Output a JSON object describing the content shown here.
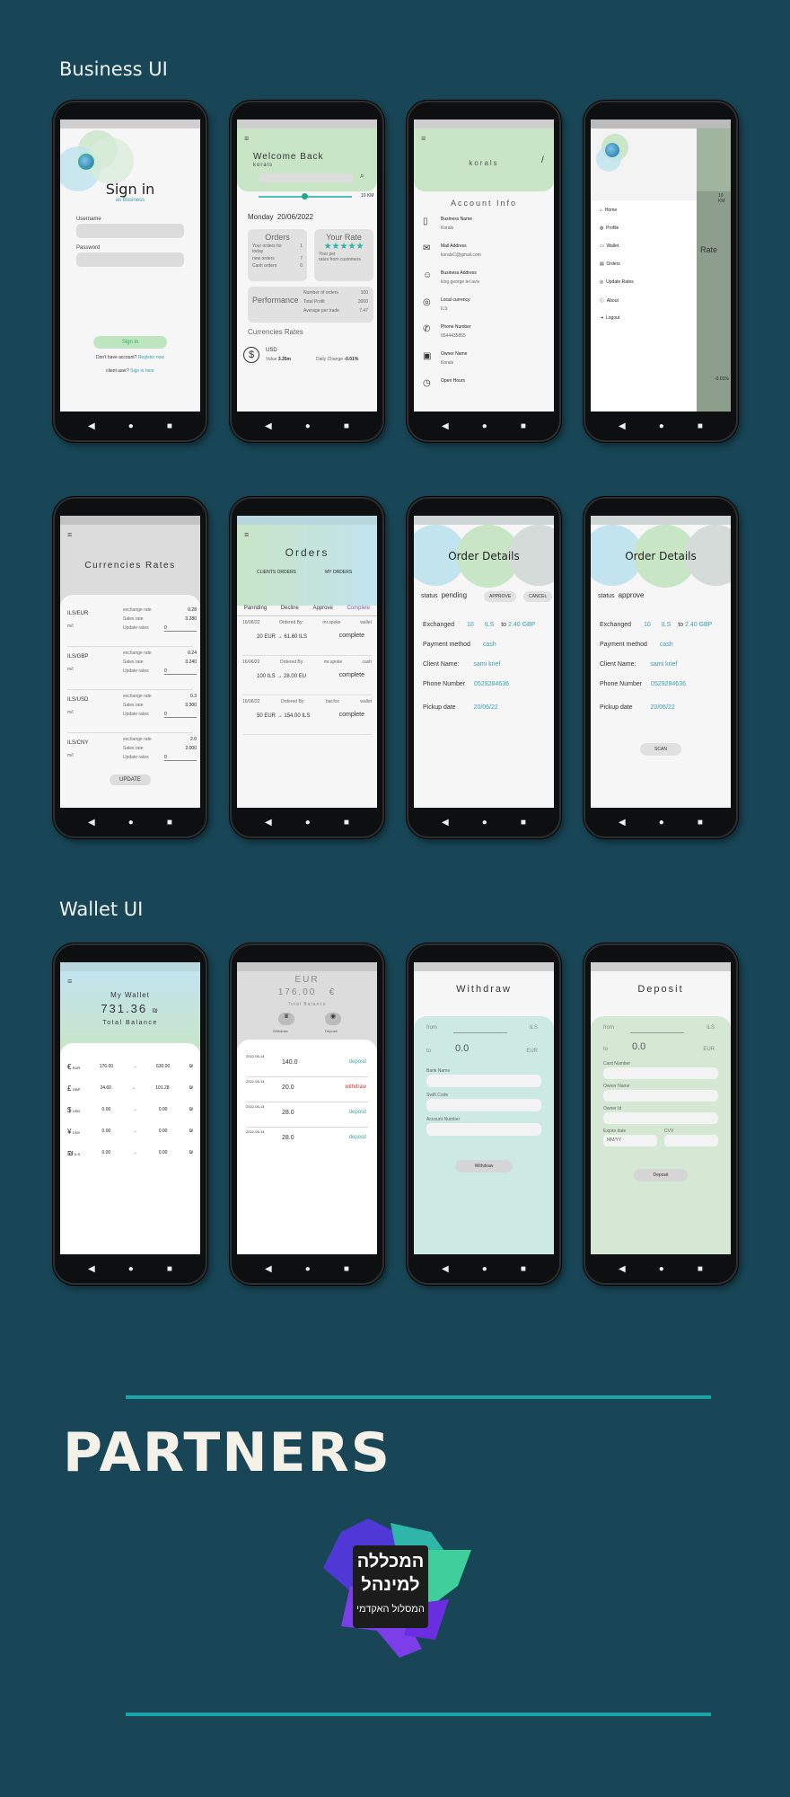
{
  "sections": {
    "business": "Business UI",
    "wallet": "Wallet UI",
    "partners": "PARTNERS"
  },
  "signin": {
    "title": "Sign in",
    "subtitle": "as Business",
    "username": "Username",
    "password": "Password",
    "button": "Sign in",
    "no_account": "Don't have account?",
    "register": "Register now",
    "client_q": "client user?",
    "client_link": "Sign in here"
  },
  "welcome": {
    "title": "Welcome Back",
    "user": "korals",
    "km": "10 KM",
    "date_label": "Monday",
    "date": "20/06/2022",
    "orders_title": "Orders",
    "orders_rows": [
      "Your orders for today",
      "new orders",
      "Cash orders"
    ],
    "orders_vals": [
      "1",
      "7",
      "0"
    ],
    "rate_title": "Your Rate",
    "rate_rows": [
      "Your pet",
      "rates from customers"
    ],
    "perf_title": "Performance",
    "perf_rows": [
      "Number of orders",
      "Total Profit",
      "Average per trade"
    ],
    "perf_vals": [
      "100",
      "2000",
      "7.47"
    ],
    "rates_title": "Currencies Rates",
    "usd": "USD",
    "value_label": "Value",
    "value": "3.35m",
    "daily": "Daily Change",
    "change": "-0.01%"
  },
  "account": {
    "user": "korals",
    "title": "Account Info",
    "items": [
      {
        "label": "Business Name",
        "value": "Korals"
      },
      {
        "label": "Mail Address",
        "value": "koralsC@gmail.com"
      },
      {
        "label": "Business Address",
        "value": "king george tel aviv"
      },
      {
        "label": "Local currency",
        "value": "ILS"
      },
      {
        "label": "Phone Number",
        "value": "0544435855"
      },
      {
        "label": "Owner Name",
        "value": "Korals"
      },
      {
        "label": "Open Hours",
        "value": ""
      }
    ]
  },
  "menu": {
    "items": [
      "Home",
      "Profile",
      "Wallet",
      "Orders",
      "Update Rates",
      "About",
      "Logout"
    ],
    "bg_km": "10 KM",
    "bg_rate": "Rate",
    "bg_change": "-0.01%"
  },
  "rates": {
    "title": "Currencies Rates",
    "pairs": [
      {
        "pair": "ILS/EUR",
        "inv": "m/i",
        "ex": "0.28",
        "sales": "0.280",
        "upd": "0"
      },
      {
        "pair": "ILS/GBP",
        "inv": "m/i",
        "ex": "0.24",
        "sales": "0.240",
        "upd": "0"
      },
      {
        "pair": "ILS/USD",
        "inv": "m/i",
        "ex": "0.3",
        "sales": "0.300",
        "upd": "0"
      },
      {
        "pair": "ILS/CNY",
        "inv": "m/i",
        "ex": "2.0",
        "sales": "2.000",
        "upd": "0"
      }
    ],
    "ex_label": "exchange rate",
    "sales_label": "Sales rate",
    "upd_label": "Update rates",
    "button": "UPDATE"
  },
  "orders": {
    "title": "Orders",
    "tab1": "CLIENTS ORDERS",
    "tab2": "MY ORDERS",
    "filters": [
      "Pannding",
      "Decline",
      "Approve",
      "Complete"
    ],
    "list": [
      {
        "date": "16/06/22",
        "by": "Ordered By:",
        "who": "mr.spoke",
        "type": "wallet",
        "amount": "20 EUR",
        "to": "61.60 ILS",
        "status": "complete"
      },
      {
        "date": "16/06/22",
        "by": "Ordered By:",
        "who": "mr.spoke",
        "type": "cash",
        "amount": "100 ILS",
        "to": "28.00 EU",
        "status": "complete"
      },
      {
        "date": "16/06/22",
        "by": "Ordered By:",
        "who": "bar.fox",
        "type": "wallet",
        "amount": "50 EUR",
        "to": "154.00 ILS",
        "status": "complete"
      }
    ]
  },
  "details1": {
    "title": "Order Details",
    "status_label": "status",
    "status": "pending",
    "approve": "APPROVE",
    "cancel": "CANCEL"
  },
  "details2": {
    "title": "Order Details",
    "status_label": "status",
    "status": "approve",
    "scan": "SCAN"
  },
  "detail_rows": {
    "exchanged": "Exchanged",
    "amt": "10",
    "cur": "ILS",
    "to": "to",
    "res": "2.40 GBP",
    "pm_label": "Payment method",
    "pm": "cash",
    "client_label": "Client Name:",
    "client": "sami krief",
    "phone_label": "Phone Number",
    "phone": "0529284636",
    "pickup_label": "Pickup date",
    "pickup": "20/06/22"
  },
  "wallet": {
    "title": "My Wallet",
    "balance": "731.36",
    "cur": "₪",
    "sub": "Total Balance",
    "rows": [
      {
        "sym": "€",
        "code": "EUR",
        "a": "176.00",
        "b": "630.00"
      },
      {
        "sym": "£",
        "code": "GBP",
        "a": "24.60",
        "b": "101.28"
      },
      {
        "sym": "$",
        "code": "USD",
        "a": "0.00",
        "b": "0.00"
      },
      {
        "sym": "¥",
        "code": "CNY",
        "a": "0.00",
        "b": "0.00"
      },
      {
        "sym": "₪",
        "code": "ILS",
        "a": "0.00",
        "b": "0.00"
      }
    ]
  },
  "eurwallet": {
    "cur": "EUR",
    "amt": "176.00",
    "sym": "€",
    "sub": "Total Balance",
    "withdraw": "Withdraw",
    "deposit": "Deposit",
    "tx": [
      {
        "date": "2022-06-14",
        "amt": "140.0",
        "type": "deposit"
      },
      {
        "date": "2022-06-14",
        "amt": "20.0",
        "type": "withdraw"
      },
      {
        "date": "2022-06-14",
        "amt": "28.0",
        "type": "deposit"
      },
      {
        "date": "2022-06-14",
        "amt": "28.0",
        "type": "deposit"
      }
    ]
  },
  "withdraw": {
    "title": "Withdraw",
    "from": "from",
    "from_cur": "ILS",
    "to": "to",
    "val": "0.0",
    "to_cur": "EUR",
    "f1": "Bank Name",
    "f2": "Swift Code",
    "f3": "Account Number",
    "button": "Withdraw"
  },
  "deposit": {
    "title": "Deposit",
    "from": "from",
    "from_cur": "ILS",
    "to": "to",
    "val": "0.0",
    "to_cur": "EUR",
    "f1": "Card Number",
    "f2": "Owner Name",
    "f3": "Owner Id",
    "f4": "Expire date",
    "f5": "CVV",
    "f4_ph": "MM/YY",
    "button": "Deposit"
  },
  "partner_logo": {
    "line1": "המכללה",
    "line2": "למינהל",
    "line3": "המסלול האקדמי"
  },
  "colors": {
    "bg": "#184656",
    "accent": "#1aa5a8",
    "green": "#c6e4c4",
    "blue": "#c7e6f0"
  }
}
